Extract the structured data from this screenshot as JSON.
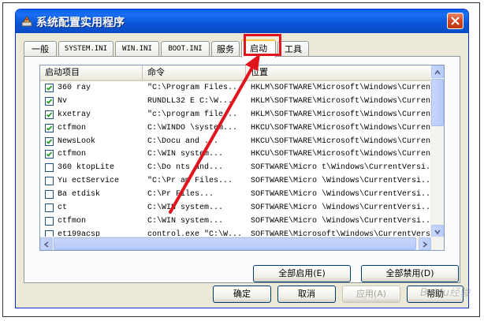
{
  "window": {
    "title": "系统配置实用程序"
  },
  "tabs": [
    {
      "label": "一般",
      "active": false
    },
    {
      "label": "SYSTEM.INI",
      "active": false
    },
    {
      "label": "WIN.INI",
      "active": false
    },
    {
      "label": "BOOT.INI",
      "active": false
    },
    {
      "label": "服务",
      "active": false
    },
    {
      "label": "启动",
      "active": true
    },
    {
      "label": "工具",
      "active": false
    }
  ],
  "table": {
    "columns": [
      "启动项目",
      "命令",
      "位置"
    ],
    "rows": [
      {
        "checked": true,
        "item": "360   ray",
        "command": "\"C:\\Program Files...",
        "location": "HKLM\\SOFTWARE\\Microsoft\\Windows\\Current..."
      },
      {
        "checked": true,
        "item": "Nv",
        "command": "RUNDLL32    E C:\\W...",
        "location": "HKLM\\SOFTWARE\\Microsoft\\Windows\\Current..."
      },
      {
        "checked": true,
        "item": "kxetray",
        "command": "\"c:\\program file...",
        "location": "HKLM\\SOFTWARE\\Microsoft\\Windows\\Current..."
      },
      {
        "checked": true,
        "item": "ctfmon",
        "command": "C:\\WINDO  \\system...",
        "location": "HKCU\\SOFTWARE\\Microsoft\\Windows\\Current..."
      },
      {
        "checked": true,
        "item": "NewsLook",
        "command": "C:\\Docu     and ...",
        "location": "HKCU\\SOFTWARE\\Microsoft\\Windows\\Current..."
      },
      {
        "checked": true,
        "item": "ctfmon",
        "command": "C:\\WIN    system...",
        "location": "HKCU\\SOFTWARE\\Microsoft\\Windows\\Current..."
      },
      {
        "checked": false,
        "item": "360    ktopLite",
        "command": "C:\\Do     nts and...",
        "location": "SOFTWARE\\Micro    t\\Windows\\CurrentVersi..."
      },
      {
        "checked": false,
        "item": "Yu     ectService",
        "command": "\"C:\\Pr   am Files...",
        "location": "SOFTWARE\\Micro    \\Windows\\CurrentVersi..."
      },
      {
        "checked": false,
        "item": "Ba     etdisk",
        "command": "C:\\Pr     Files...",
        "location": "SOFTWARE\\Micro    \\Windows\\CurrentVersi..."
      },
      {
        "checked": false,
        "item": "ct",
        "command": "C:\\WIN    system...",
        "location": "SOFTWARE\\Micro    \\Windows\\CurrentVersi..."
      },
      {
        "checked": false,
        "item": "ctfmon",
        "command": "C:\\WIN    system...",
        "location": "SOFTWARE\\Micro    \\Windows\\CurrentVersi..."
      },
      {
        "checked": false,
        "item": "et199acsp",
        "command": "control.exe \"C:\\W...",
        "location": "SOFTWARE\\Microsoft\\Windows\\CurrentVersi..."
      }
    ]
  },
  "buttons": {
    "enable_all": "全部启用(E)",
    "disable_all": "全部禁用(D)",
    "ok": "确定",
    "cancel": "取消",
    "apply": "应用(A)",
    "help": "帮助"
  },
  "colors": {
    "title_bar": "#0a55d6",
    "annotation": "#e1141e",
    "active_tab_accent": "#ffc83c"
  },
  "watermark": "Baidu经验"
}
